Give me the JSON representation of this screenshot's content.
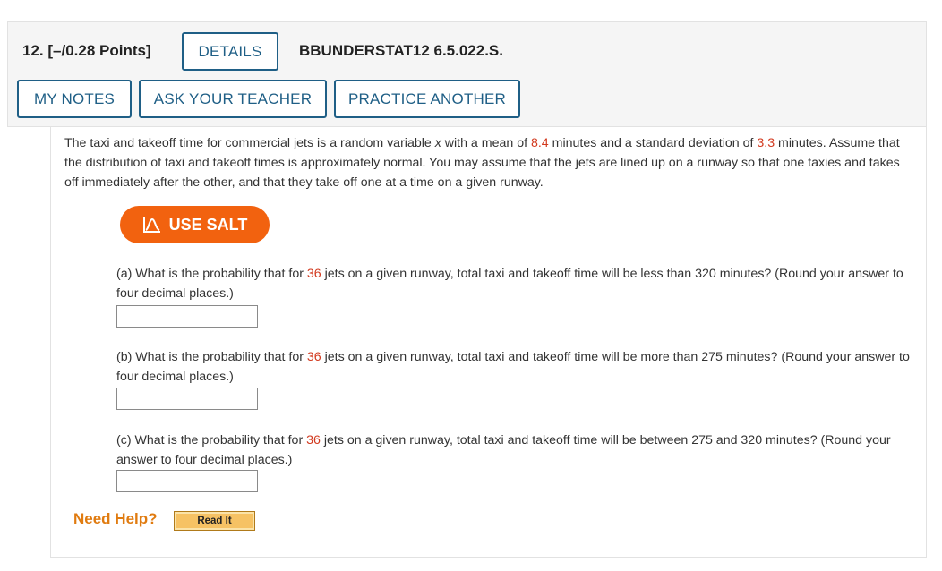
{
  "header": {
    "question_number": "12.",
    "points": "[–/0.28 Points]",
    "details_label": "DETAILS",
    "reference": "BBUNDERSTAT12 6.5.022.S.",
    "my_notes_label": "MY NOTES",
    "ask_teacher_label": "ASK YOUR TEACHER",
    "practice_label": "PRACTICE ANOTHER"
  },
  "intro": {
    "t1": "The taxi and takeoff time for commercial jets is a random variable ",
    "var": "x",
    "t2": " with a mean of ",
    "mean": "8.4",
    "t3": " minutes and a standard deviation of ",
    "sd": "3.3",
    "t4": " minutes. Assume that the distribution of taxi and takeoff times is approximately normal. You may assume that the jets are lined up on a runway so that one taxies and takes off immediately after the other, and that they take off one at a time on a given runway."
  },
  "salt": {
    "label": "USE SALT",
    "icon": "salt-chart-icon"
  },
  "parts": {
    "a": {
      "pre": "(a) What is the probability that for ",
      "n": "36",
      "post": " jets on a given runway, total taxi and takeoff time will be less than 320 minutes? (Round your answer to four decimal places.)",
      "answer": ""
    },
    "b": {
      "pre": "(b) What is the probability that for ",
      "n": "36",
      "post": " jets on a given runway, total taxi and takeoff time will be more than 275 minutes? (Round your answer to four decimal places.)",
      "answer": ""
    },
    "c": {
      "pre": "(c) What is the probability that for ",
      "n": "36",
      "post": " jets on a given runway, total taxi and takeoff time will be between 275 and 320 minutes? (Round your answer to four decimal places.)",
      "answer": ""
    }
  },
  "help": {
    "label": "Need Help?",
    "read_it_label": "Read It"
  },
  "colors": {
    "button_border": "#1f5f86",
    "highlight_value": "#d2391e",
    "salt_button": "#f2620f",
    "need_help": "#e07b10",
    "read_it_bg": "#f6c264"
  }
}
